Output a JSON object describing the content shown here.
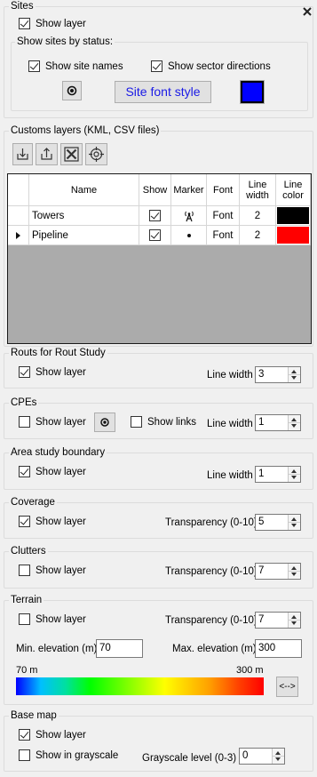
{
  "colors": {
    "panel_bg": "#f0f0f0",
    "site_color_swatch": "#0000ff",
    "site_font_label": "#1a1ae6",
    "tower_line_color": "#000000",
    "pipeline_line_color": "#ff0000"
  },
  "sites": {
    "title": "Sites",
    "show_layer_label": "Show layer",
    "show_layer_checked": true,
    "by_status": {
      "title": "Show sites by status:",
      "show_site_names_label": "Show site names",
      "show_site_names_checked": true,
      "show_sector_directions_label": "Show sector directions",
      "show_sector_directions_checked": true,
      "site_font_button": "Site font style",
      "marker_icon": "target-dot-icon"
    }
  },
  "custom_layers": {
    "title": "Customs layers (KML, CSV files)",
    "toolbar": [
      "import-icon",
      "export-icon",
      "delete-icon",
      "locate-icon"
    ],
    "columns": [
      "Name",
      "Show",
      "Marker",
      "Font",
      "Line width",
      "Line color"
    ],
    "rows": [
      {
        "name": "Towers",
        "show": true,
        "marker": "antenna-icon",
        "font": "Font",
        "line_width": "2",
        "line_color": "#000000",
        "current": false
      },
      {
        "name": "Pipeline",
        "show": true,
        "marker": "dot-icon",
        "font": "Font",
        "line_width": "2",
        "line_color": "#ff0000",
        "current": true
      }
    ]
  },
  "routes": {
    "title": "Routs for Rout Study",
    "show_layer_label": "Show layer",
    "show_layer_checked": true,
    "line_width_label": "Line width",
    "line_width": "3"
  },
  "cpes": {
    "title": "CPEs",
    "show_layer_label": "Show layer",
    "show_layer_checked": false,
    "show_links_label": "Show links",
    "show_links_checked": false,
    "line_width_label": "Line width",
    "line_width": "1"
  },
  "area_study": {
    "title": "Area study boundary",
    "show_layer_label": "Show layer",
    "show_layer_checked": true,
    "line_width_label": "Line width",
    "line_width": "1"
  },
  "coverage": {
    "title": "Coverage",
    "show_layer_label": "Show layer",
    "show_layer_checked": true,
    "transparency_label": "Transparency (0-10)",
    "transparency": "5"
  },
  "clutters": {
    "title": "Clutters",
    "show_layer_label": "Show layer",
    "show_layer_checked": false,
    "transparency_label": "Transparency (0-10)",
    "transparency": "7"
  },
  "terrain": {
    "title": "Terrain",
    "show_layer_label": "Show layer",
    "show_layer_checked": false,
    "transparency_label": "Transparency (0-10)",
    "transparency": "7",
    "min_label": "Min. elevation (m)",
    "min_value": "70",
    "max_label": "Max. elevation (m)",
    "max_value": "300",
    "scale_min": "70 m",
    "scale_max": "300 m",
    "swap_button": "<-->"
  },
  "base_map": {
    "title": "Base map",
    "show_layer_label": "Show layer",
    "show_layer_checked": true,
    "grayscale_label": "Show in grayscale",
    "grayscale_checked": false,
    "grayscale_level_label": "Grayscale level (0-3)",
    "grayscale_level": "0"
  },
  "close_icon": "close-icon"
}
